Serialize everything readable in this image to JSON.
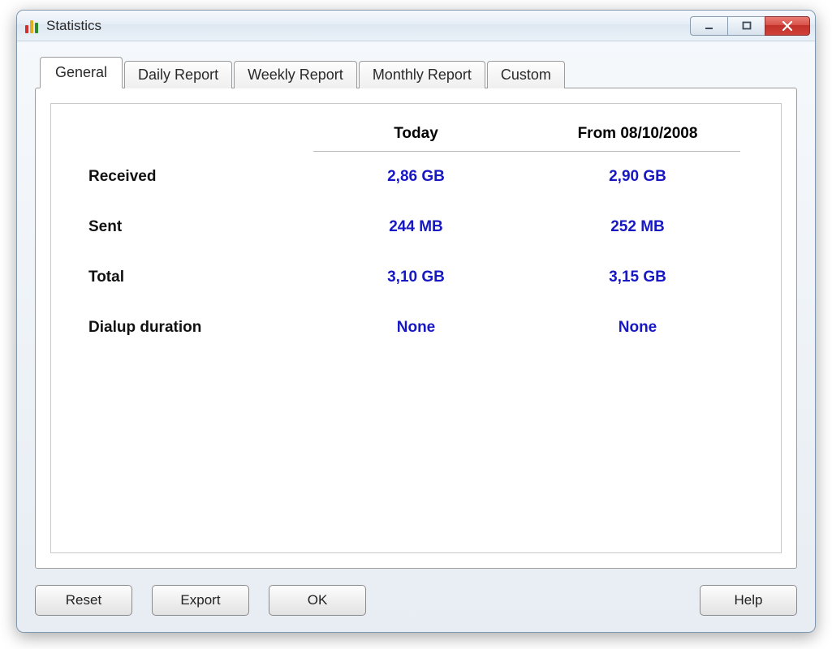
{
  "window": {
    "title": "Statistics"
  },
  "tabs": [
    {
      "label": "General",
      "active": true
    },
    {
      "label": "Daily Report",
      "active": false
    },
    {
      "label": "Weekly Report",
      "active": false
    },
    {
      "label": "Monthly Report",
      "active": false
    },
    {
      "label": "Custom",
      "active": false
    }
  ],
  "columns": {
    "col1": "Today",
    "col2": "From 08/10/2008"
  },
  "rows": [
    {
      "label": "Received",
      "today": "2,86 GB",
      "from": "2,90 GB"
    },
    {
      "label": "Sent",
      "today": "244 MB",
      "from": "252 MB"
    },
    {
      "label": "Total",
      "today": "3,10 GB",
      "from": "3,15 GB"
    },
    {
      "label": "Dialup duration",
      "today": "None",
      "from": "None"
    }
  ],
  "buttons": {
    "reset": "Reset",
    "export": "Export",
    "ok": "OK",
    "help": "Help"
  }
}
